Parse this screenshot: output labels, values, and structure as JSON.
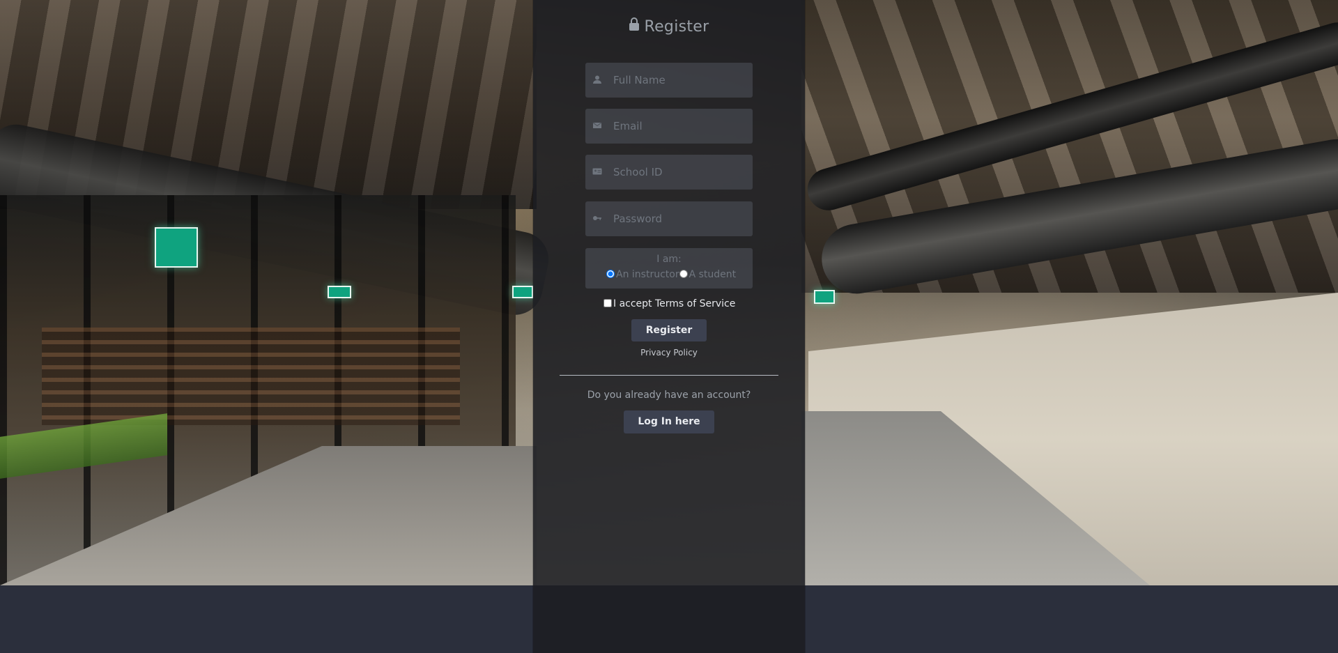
{
  "form": {
    "title": "Register",
    "fields": {
      "full_name": {
        "placeholder": "Full Name",
        "icon": "user-icon"
      },
      "email": {
        "placeholder": "Email",
        "icon": "envelope-icon"
      },
      "school_id": {
        "placeholder": "School ID",
        "icon": "id-card-icon"
      },
      "password": {
        "placeholder": "Password",
        "icon": "key-icon"
      }
    },
    "role": {
      "label": "I am:",
      "options": [
        "An instructor",
        "A student"
      ],
      "selected": "An instructor"
    },
    "terms_label": "I accept Terms of Service",
    "register_label": "Register",
    "privacy_label": "Privacy Policy",
    "have_account_text": "Do you already have an account?",
    "login_label": "Log In here"
  },
  "colors": {
    "panel_bg": "#1c1e22",
    "button_bg": "#3c4150",
    "bottom_band": "#2b2f3c"
  }
}
